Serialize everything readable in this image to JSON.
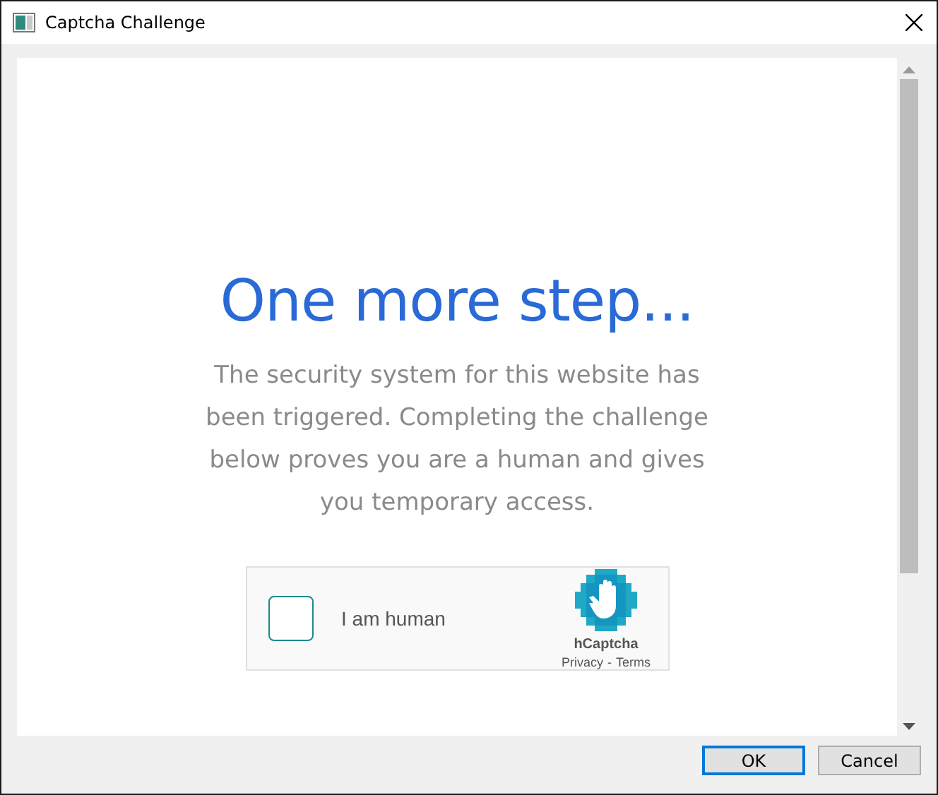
{
  "window": {
    "title": "Captcha Challenge"
  },
  "page": {
    "heading": "One more step...",
    "message": "The security system for this website has been triggered. Completing the challenge below proves you are a human and gives you temporary access."
  },
  "captcha": {
    "label": "I am human",
    "checked": false,
    "brand": "hCaptcha",
    "privacy": "Privacy",
    "separator": "-",
    "terms": "Terms"
  },
  "buttons": [
    {
      "label": "OK",
      "default": true
    },
    {
      "label": "Cancel",
      "default": false
    }
  ]
}
